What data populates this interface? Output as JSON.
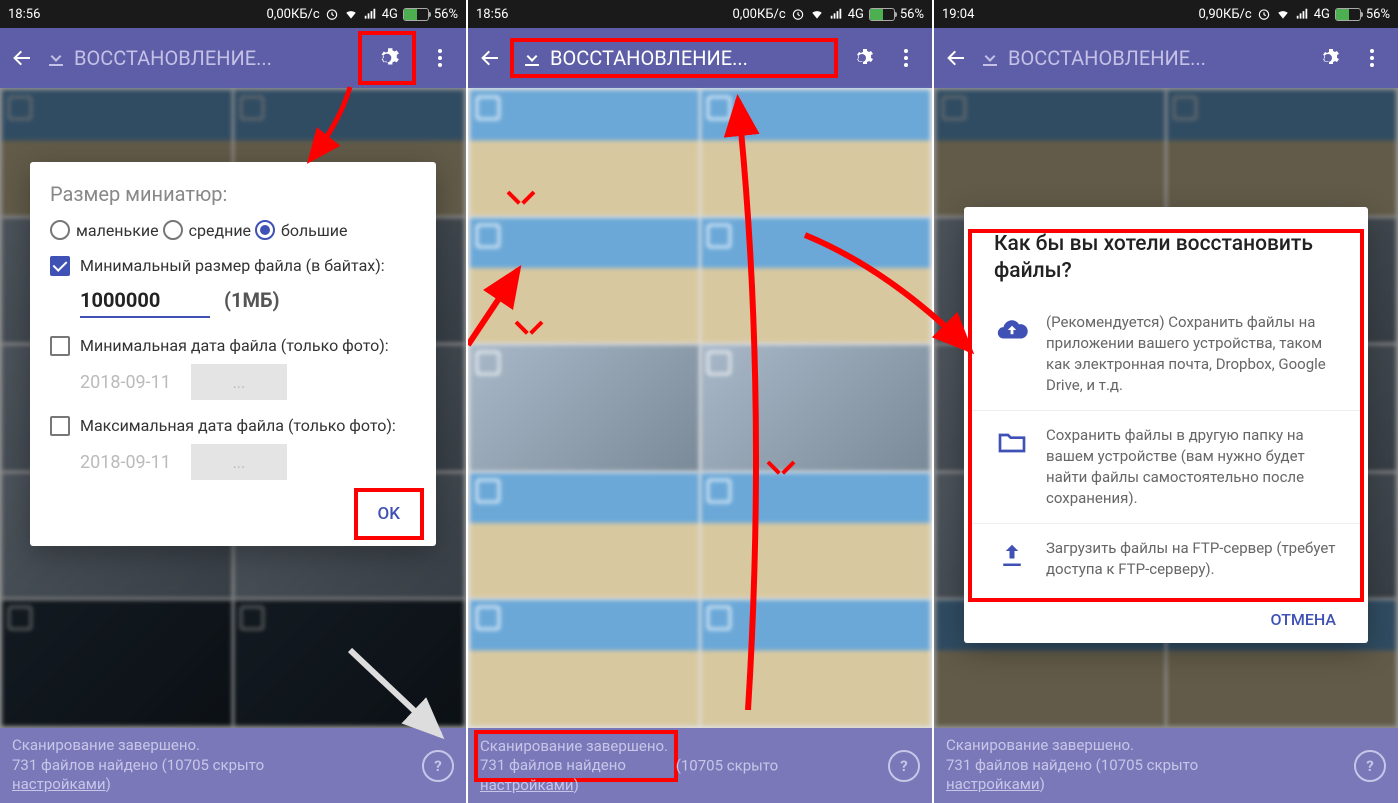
{
  "status": {
    "time1": "18:56",
    "time2": "18:56",
    "time3": "19:04",
    "net1": "0,00КБ/с",
    "net2": "0,00КБ/с",
    "net3": "0,90КБ/с",
    "sig": "4G",
    "batt": "56%"
  },
  "appbar": {
    "title": "ВОССТАНОВЛЕНИЕ..."
  },
  "dialog1": {
    "title": "Размер миниатюр:",
    "r1": "маленькие",
    "r2": "средние",
    "r3": "большие",
    "c1": "Минимальный размер файла (в байтах):",
    "input": "1000000",
    "hint": "(1МБ)",
    "c2": "Минимальная дата файла (только фото):",
    "date": "2018-09-11",
    "dots": "...",
    "c3": "Максимальная дата файла (только фото):",
    "ok": "OK"
  },
  "dialog3": {
    "title": "Как бы вы хотели восстановить файлы?",
    "o1": "(Рекомендуется) Сохранить файлы на приложении вашего устройства, таком как электронная почта, Dropbox, Google Drive, и т.д.",
    "o2": "Сохранить файлы в другую папку на вашем устройстве (вам нужно будет найти файлы самостоятельно после сохранения).",
    "o3": "Загрузить файлы на FTP-сервер (требует доступа к FTP-серверу).",
    "cancel": "ОТМЕНА"
  },
  "footer": {
    "l1": "Сканирование завершено.",
    "l2a": "731 файлов найдено",
    "l2b": " (10705 скрыто ",
    "l3": "настройками",
    "l3b": ")"
  }
}
